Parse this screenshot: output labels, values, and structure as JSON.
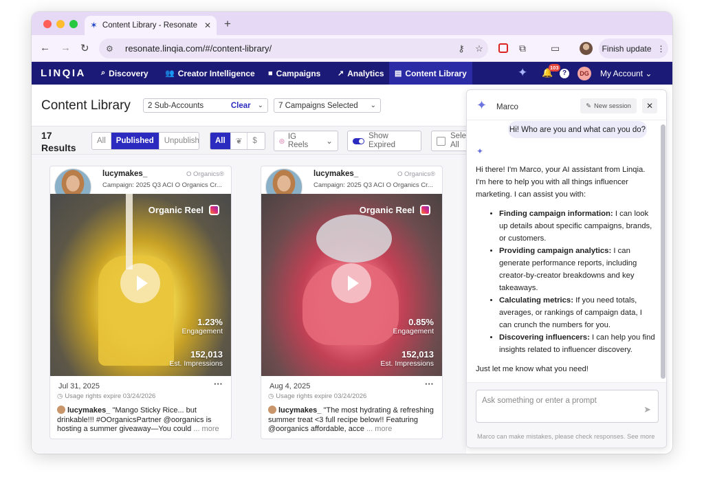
{
  "browser": {
    "tab_title": "Content Library - Resonate",
    "url": "resonate.linqia.com/#/content-library/",
    "finish_update": "Finish update"
  },
  "nav": {
    "logo": "LINQIA",
    "items": [
      {
        "label": "Discovery",
        "icon": "search-icon"
      },
      {
        "label": "Creator Intelligence",
        "icon": "people-icon"
      },
      {
        "label": "Campaigns",
        "icon": "briefcase-icon"
      },
      {
        "label": "Analytics",
        "icon": "trend-icon"
      },
      {
        "label": "Content Library",
        "icon": "library-icon"
      }
    ],
    "notif_count": "103",
    "avatar_initials": "DG",
    "my_account": "My Account"
  },
  "header": {
    "title": "Content Library",
    "subaccounts": "2 Sub-Accounts",
    "clear": "Clear",
    "campaigns": "7 Campaigns Selected"
  },
  "filters": {
    "results_count": "17",
    "results_label": "Results",
    "status_tabs": [
      "All",
      "Published",
      "Unpublished"
    ],
    "type_all": "All",
    "format_line1": "IG",
    "format_line2": "Reels",
    "show_expired_1": "Show",
    "show_expired_2": "Expired",
    "select_all_1": "Sele",
    "select_all_2": "All"
  },
  "cards": [
    {
      "username": "lucymakes_",
      "brand": "O Organics®",
      "campaign": "Campaign: 2025 Q3 ACI O Organics Cr...",
      "label": "Organic Reel",
      "engagement": "1.23%",
      "engagement_label": "Engagement",
      "impressions": "152,013",
      "impressions_label": "Est. Impressions",
      "date": "Jul 31, 2025",
      "usage": "Usage rights expire 03/24/2026",
      "caption_user": "lucymakes_",
      "caption": "\"Mango Sticky Rice... but drinkable!!! #OOrganicsPartner @oorganics is hosting a summer giveaway—You could",
      "more": "... more"
    },
    {
      "username": "lucymakes_",
      "brand": "O Organics®",
      "campaign": "Campaign: 2025 Q3 ACI O Organics Cr...",
      "label": "Organic Reel",
      "engagement": "0.85%",
      "engagement_label": "Engagement",
      "impressions": "152,013",
      "impressions_label": "Est. Impressions",
      "date": "Aug 4, 2025",
      "usage": "Usage rights expire 03/24/2026",
      "caption_user": "lucymakes_",
      "caption": "\"The most hydrating & refreshing summer treat <3 full recipe below!! Featuring @oorganics affordable, acce",
      "more": "... more"
    }
  ],
  "marco": {
    "title": "Marco",
    "new_session": "New session",
    "user_msg": "Hi! Who are you and what can you do?",
    "intro": "Hi there! I'm Marco, your AI assistant from Linqia. I'm here to help you with all things influencer marketing. I can assist you with:",
    "bullets": [
      {
        "bold": "Finding campaign information:",
        "text": " I can look up details about specific campaigns, brands, or customers."
      },
      {
        "bold": "Providing campaign analytics:",
        "text": " I can generate performance reports, including creator-by-creator breakdowns and key takeaways."
      },
      {
        "bold": "Calculating metrics:",
        "text": " If you need totals, averages, or rankings of campaign data, I can crunch the numbers for you."
      },
      {
        "bold": "Discovering influencers:",
        "text": " I can help you find insights related to influencer discovery."
      }
    ],
    "outro": "Just let me know what you need!",
    "placeholder": "Ask something or enter a prompt",
    "disclaimer": "Marco can make mistakes, please check responses. See more"
  },
  "colors": {
    "nav_bg": "#1c1a77",
    "accent": "#2b2bbf",
    "chrome": "#e6d9f6"
  }
}
